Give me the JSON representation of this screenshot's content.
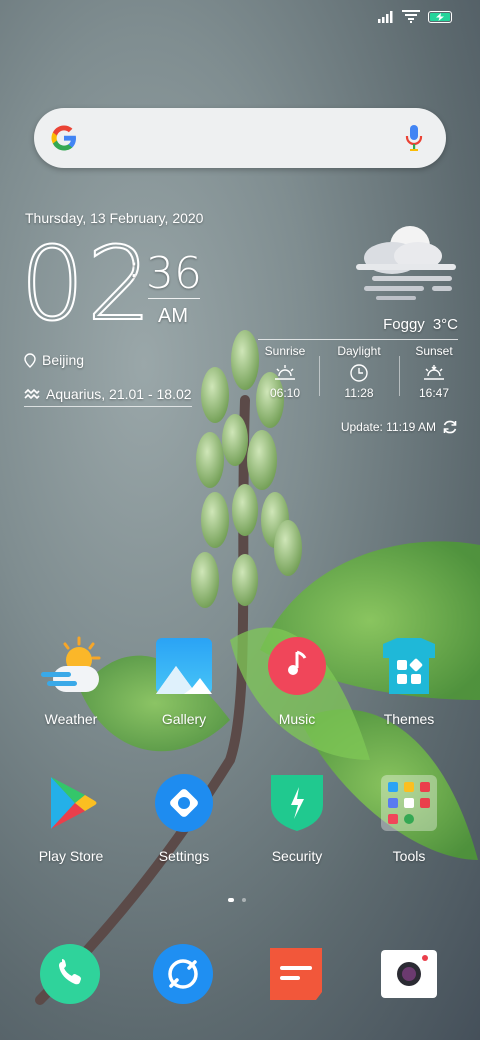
{
  "status_bar": {
    "icons": [
      "signal-icon",
      "wifi-icon",
      "battery-charging-icon"
    ],
    "battery_level": 0.9,
    "battery_color": "#25d39a"
  },
  "search": {
    "logo": "google-g-icon",
    "mic": "microphone-icon"
  },
  "clock": {
    "date": "Thursday, 13 February, 2020",
    "hour": "02",
    "colon": ":",
    "minute": "36",
    "ampm": "AM",
    "location": "Beijing",
    "zodiac": "Aquarius, 21.01 - 18.02"
  },
  "weather": {
    "icon": "foggy-cloud-icon",
    "condition": "Foggy",
    "temperature": "3°C",
    "sunrise_label": "Sunrise",
    "sunrise_time": "06:10",
    "daylight_label": "Daylight",
    "daylight_time": "11:28",
    "sunset_label": "Sunset",
    "sunset_time": "16:47",
    "update": "Update: 11:19 AM"
  },
  "apps": [
    {
      "label": "Weather",
      "icon": "weather-icon"
    },
    {
      "label": "Gallery",
      "icon": "gallery-icon"
    },
    {
      "label": "Music",
      "icon": "music-icon"
    },
    {
      "label": "Themes",
      "icon": "themes-icon"
    },
    {
      "label": "Play Store",
      "icon": "play-store-icon"
    },
    {
      "label": "Settings",
      "icon": "settings-icon"
    },
    {
      "label": "Security",
      "icon": "security-icon"
    },
    {
      "label": "Tools",
      "icon": "tools-folder-icon"
    }
  ],
  "page_indicator": {
    "current": 1,
    "total": 2
  },
  "dock": [
    {
      "icon": "phone-icon"
    },
    {
      "icon": "messages-icon"
    },
    {
      "icon": "notes-icon"
    },
    {
      "icon": "camera-icon"
    }
  ],
  "colors": {
    "music": "#f0465a",
    "settings": "#1e8cf0",
    "security": "#20c98f",
    "themes": "#1fb8d8",
    "phone": "#2fd39b",
    "messages": "#1f8ff2",
    "notes": "#f2573a"
  }
}
